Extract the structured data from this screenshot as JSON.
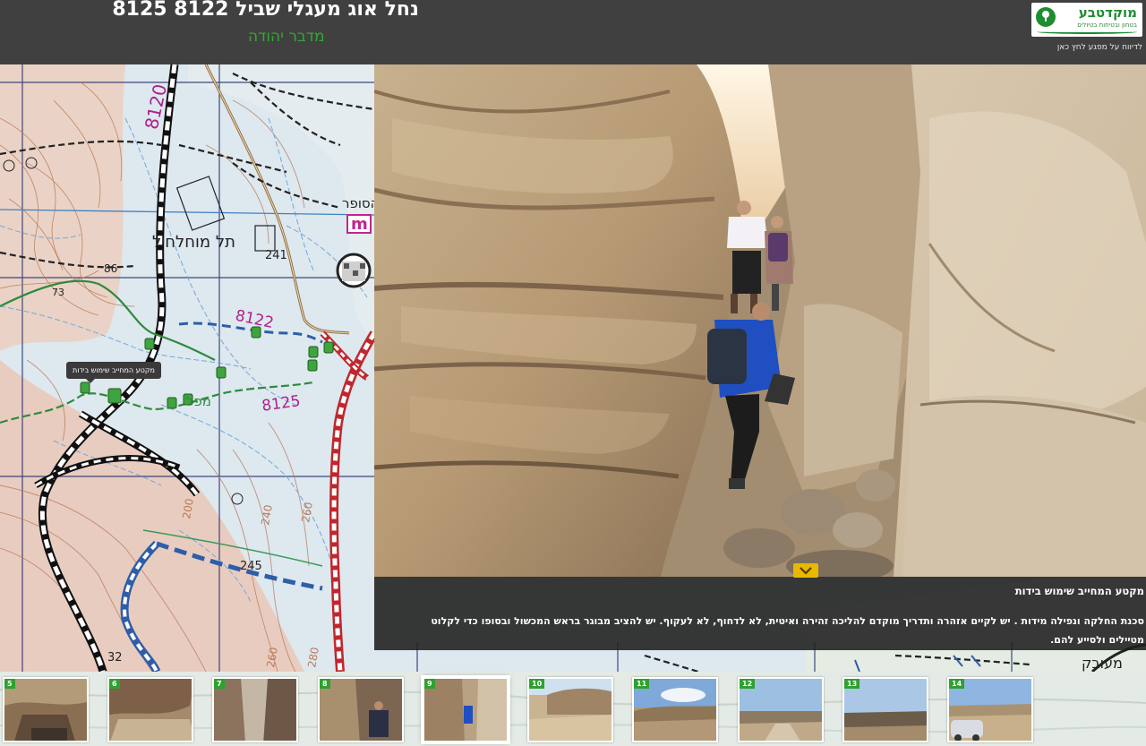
{
  "header": {
    "title": "נחל אוג מעגלי שביל 8122 8125",
    "subtitle": "מדבר יהודה",
    "logo": {
      "name": "מוקדטבע",
      "tagline": "בטחון ובטיחות בטיולים"
    },
    "report_link": "לדיווח על מפגע לחץ כאן"
  },
  "map": {
    "tooltip": "מקטע המחייב שימוש בידות",
    "labels": {
      "hill": "תל מוחלחיל",
      "hill_height": "86",
      "height_73": "73",
      "sofer": "הסופר",
      "m_marker": "m",
      "spot_241": "241",
      "trail_8120": "8120",
      "trail_8122": "8122",
      "trail_8125": "8125",
      "mapal": "מפל",
      "h200": "200",
      "h240": "240",
      "h260": "260",
      "h245": "245",
      "h32": "32",
      "h260b": "260",
      "h280": "280",
      "maarav": "מעובק"
    }
  },
  "caption": {
    "title": "מקטע המחייב שימוש בידות",
    "text": "סכנת החלקה ונפילה מידות . יש לקיים אזהרה ותדריך מוקדם להליכה זהירה ואיטית, לא לדחוף, לא לעקוף. יש להציב מבוגר בראש המכשול ובסופו כדי לקלוט מטיילים ולסייע להם."
  },
  "thumbnails": [
    {
      "num": "5"
    },
    {
      "num": "6"
    },
    {
      "num": "7"
    },
    {
      "num": "8"
    },
    {
      "num": "9"
    },
    {
      "num": "10"
    },
    {
      "num": "11"
    },
    {
      "num": "12"
    },
    {
      "num": "13"
    },
    {
      "num": "14"
    }
  ],
  "active_thumbnail": "9",
  "colors": {
    "header_bg": "#404040",
    "accent_green": "#2faa2f",
    "collapse_yellow": "#e9b800"
  },
  "icons": {
    "collapse": "chevron-down-icon",
    "logo": "tree-icon",
    "trail_marker": "trail-marker-icon"
  }
}
